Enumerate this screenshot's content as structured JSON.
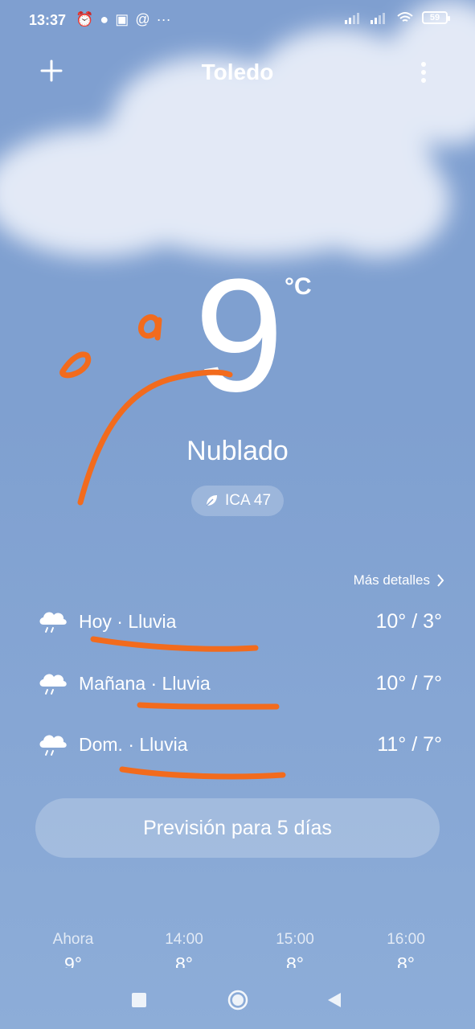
{
  "status_bar": {
    "time": "13:37",
    "battery": "59"
  },
  "header": {
    "city": "Toledo"
  },
  "current": {
    "temp": "9",
    "unit": "°C",
    "condition": "Nublado",
    "aqi": "ICA 47"
  },
  "details_link": "Más detalles",
  "days": [
    {
      "label": "Hoy · Lluvia",
      "range": "10° / 3°",
      "icon": "rain-cloud-icon"
    },
    {
      "label": "Mañana · Lluvia",
      "range": "10° / 7°",
      "icon": "rain-cloud-icon"
    },
    {
      "label": "Dom. · Lluvia",
      "range": "11° / 7°",
      "icon": "rain-cloud-icon"
    }
  ],
  "forecast_button": "Previsión para 5 días",
  "hours": [
    {
      "time": "Ahora",
      "temp": "9°"
    },
    {
      "time": "14:00",
      "temp": "8°"
    },
    {
      "time": "15:00",
      "temp": "8°"
    },
    {
      "time": "16:00",
      "temp": "8°"
    }
  ],
  "annotation_color": "#f26b1d"
}
